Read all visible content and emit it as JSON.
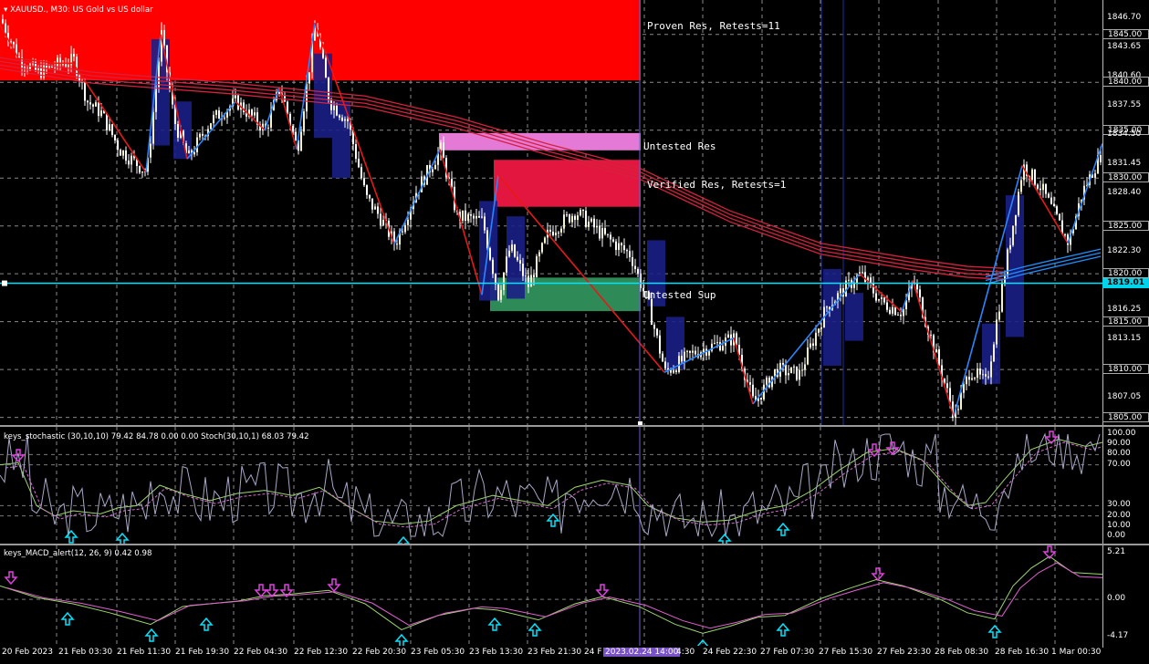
{
  "header": {
    "symbol": "XAUUSD.",
    "timeframe": "M30",
    "description": "US Gold vs US dollar",
    "title": "XAUUSD., M30:  US Gold vs US dollar"
  },
  "colors": {
    "background": "#000000",
    "bull_candle": "#f5f1c8",
    "bear_candle": "#ffffff",
    "resistance_proven": "#ff0000",
    "resistance_untested": "#e47ad6",
    "resistance_verified": "#e3163f",
    "support_untested": "#2e8b57",
    "horizontal_line": "#00e5ff",
    "ma_ribbon": "#d6213e",
    "ma_ribbon_blue": "#1e90ff",
    "zigzag_up": "#2a86ff",
    "zigzag_down": "#e81818",
    "highlight_bar": "#1b1f86"
  },
  "zones": {
    "proven_res": "Proven Res, Retests=11",
    "untested_res": "Untested Res",
    "verified_res": "Verified Res, Retests=1",
    "untested_sup": "Untested Sup"
  },
  "price_axis": {
    "min": 1804.2,
    "max": 1848.6,
    "ticks": [
      "1846.70",
      "1845.00",
      "1843.65",
      "1840.60",
      "1840.00",
      "1837.55",
      "1835.00",
      "1834.50",
      "1831.45",
      "1830.00",
      "1828.40",
      "1825.00",
      "1822.30",
      "1820.00",
      "1819.01",
      "1816.25",
      "1815.00",
      "1813.15",
      "1810.00",
      "1807.05",
      "1805.00"
    ],
    "boxed": [
      "1845.00",
      "1840.00",
      "1835.00",
      "1830.00",
      "1825.00",
      "1820.00",
      "1815.00",
      "1810.00",
      "1805.00"
    ],
    "current": "1819.01"
  },
  "stochastic": {
    "label": "keys_stochastic (30,10,10) 79.42 84.78 0.00 0.00 Stoch(30,10,1) 68.03 79.42",
    "ticks": [
      "100.00",
      "90.00",
      "80.00",
      "70.00",
      "30.00",
      "20.00",
      "10.00",
      "0.00"
    ]
  },
  "macd": {
    "label": "keys_MACD_alert(12, 26, 9) 0.42 0.98",
    "ticks": [
      "5.21",
      "0.00",
      "-4.17"
    ]
  },
  "time_axis": {
    "labels": [
      "20 Feb 2023",
      "21 Feb 03:30",
      "21 Feb 11:30",
      "21 Feb 19:30",
      "22 Feb 04:30",
      "22 Feb 12:30",
      "22 Feb 20:30",
      "23 Feb 05:30",
      "23 Feb 13:30",
      "23 Feb 21:30",
      "24 F",
      "24 Feb 22:30",
      "27 Feb 07:30",
      "27 Feb 15:30",
      "27 Feb 23:30",
      "28 Feb 08:30",
      "28 Feb 16:30",
      "1 Mar 00:30"
    ],
    "cursor_label": "2023.02.24 14:00",
    "cursor_suffix": "4:30"
  }
}
